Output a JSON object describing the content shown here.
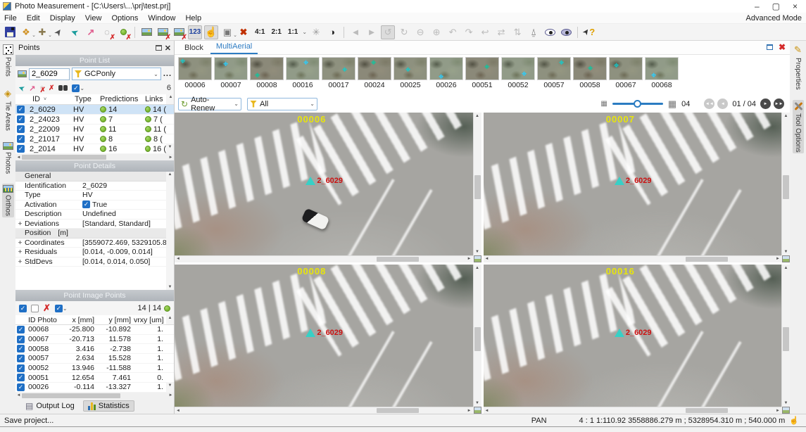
{
  "window": {
    "title": "Photo Measurement - [C:\\Users\\...\\prj\\test.prj]",
    "mode": "Advanced Mode",
    "minimize": "–",
    "maximize": "▢",
    "close": "×"
  },
  "menu": {
    "items": [
      "File",
      "Edit",
      "Display",
      "View",
      "Options",
      "Window",
      "Help"
    ]
  },
  "toolbar": {
    "numbers_label": "123",
    "zoom_4_1": "4:1",
    "zoom_2_1": "2:1",
    "zoom_1_1": "1:1"
  },
  "left_tabs": {
    "points": "Points",
    "tie_areas": "Tie Areas",
    "photos": "Photos",
    "orthos": "Orthos"
  },
  "right_tabs": {
    "properties": "Properties",
    "tool_options": "Tool Options"
  },
  "points_panel": {
    "title": "Points",
    "point_list": {
      "header": "Point List",
      "point_id_value": "2_6029",
      "filter_value": "GCPonly",
      "more_label": "...",
      "count": "6",
      "columns": {
        "id": "ID",
        "type": "Type",
        "predictions": "Predictions",
        "links": "Links"
      },
      "rows": [
        {
          "id": "2_6029",
          "type": "HV",
          "pred": "14",
          "links": "14 ("
        },
        {
          "id": "2_24023",
          "type": "HV",
          "pred": "7",
          "links": "7 ("
        },
        {
          "id": "2_22009",
          "type": "HV",
          "pred": "11",
          "links": "11 ("
        },
        {
          "id": "2_21017",
          "type": "HV",
          "pred": "8",
          "links": "8 ("
        },
        {
          "id": "2_2014",
          "type": "HV",
          "pred": "16",
          "links": "16 ("
        }
      ]
    },
    "point_details": {
      "header": "Point Details",
      "group_general": "General",
      "rows_general": [
        {
          "label": "Identification",
          "value": "2_6029"
        },
        {
          "label": "Type",
          "value": "HV"
        },
        {
          "label": "Activation",
          "value": "True"
        },
        {
          "label": "Description",
          "value": "Undefined"
        },
        {
          "label": "Deviations",
          "value": "[Standard, Standard]",
          "exp": "+"
        }
      ],
      "group_position": "Position",
      "group_position_unit": "[m]",
      "rows_position": [
        {
          "label": "Coordinates",
          "value": "[3559072.469, 5329105.84...",
          "exp": "+"
        },
        {
          "label": "Residuals",
          "value": "[0.014, -0.009, 0.014]",
          "exp": "+"
        },
        {
          "label": "StdDevs",
          "value": "[0.014, 0.014, 0.050]",
          "exp": "+"
        }
      ]
    },
    "point_image_points": {
      "header": "Point Image Points",
      "count": "14 | 14",
      "columns": {
        "id": "ID Photo",
        "x": "x [mm]",
        "y": "y [mm]",
        "v": "vrxy [um]"
      },
      "rows": [
        {
          "id": "00068",
          "x": "-25.800",
          "y": "-10.892",
          "v": "1."
        },
        {
          "id": "00067",
          "x": "-20.713",
          "y": "11.578",
          "v": "1."
        },
        {
          "id": "00058",
          "x": "3.416",
          "y": "-2.738",
          "v": "1."
        },
        {
          "id": "00057",
          "x": "2.634",
          "y": "15.528",
          "v": "1."
        },
        {
          "id": "00052",
          "x": "13.946",
          "y": "-11.588",
          "v": "1."
        },
        {
          "id": "00051",
          "x": "12.654",
          "y": "7.461",
          "v": "0."
        },
        {
          "id": "00026",
          "x": "-0.114",
          "y": "-13.327",
          "v": "1."
        }
      ]
    },
    "bottom_tabs": {
      "output_log": "Output Log",
      "statistics": "Statistics"
    }
  },
  "main": {
    "tabs": {
      "block": "Block",
      "multiaerial": "MultiAerial"
    },
    "thumbnails": [
      "00006",
      "00007",
      "00008",
      "00016",
      "00017",
      "00024",
      "00025",
      "00026",
      "00051",
      "00052",
      "00057",
      "00058",
      "00067",
      "00068"
    ],
    "controls": {
      "auto_renew": "Auto-Renew",
      "filter_all": "All",
      "level": "04",
      "page": "01 / 04"
    },
    "viewports": [
      {
        "label": "00006",
        "marker": "2_6029"
      },
      {
        "label": "00007",
        "marker": "2_6029"
      },
      {
        "label": "00008",
        "marker": "2_6029"
      },
      {
        "label": "00016",
        "marker": "2_6029"
      }
    ]
  },
  "status": {
    "message": "Save project...",
    "mode": "PAN",
    "readout": "4 : 1  1:110.92  3558886.279 m ; 5328954.310 m ; 540.000 m"
  },
  "colors": {
    "accent": "#2e7cc3",
    "marker_text": "#cc1111",
    "marker_tri": "#23d7cd",
    "label_yellow": "#e8e50a",
    "status_green": "#76b52c"
  }
}
